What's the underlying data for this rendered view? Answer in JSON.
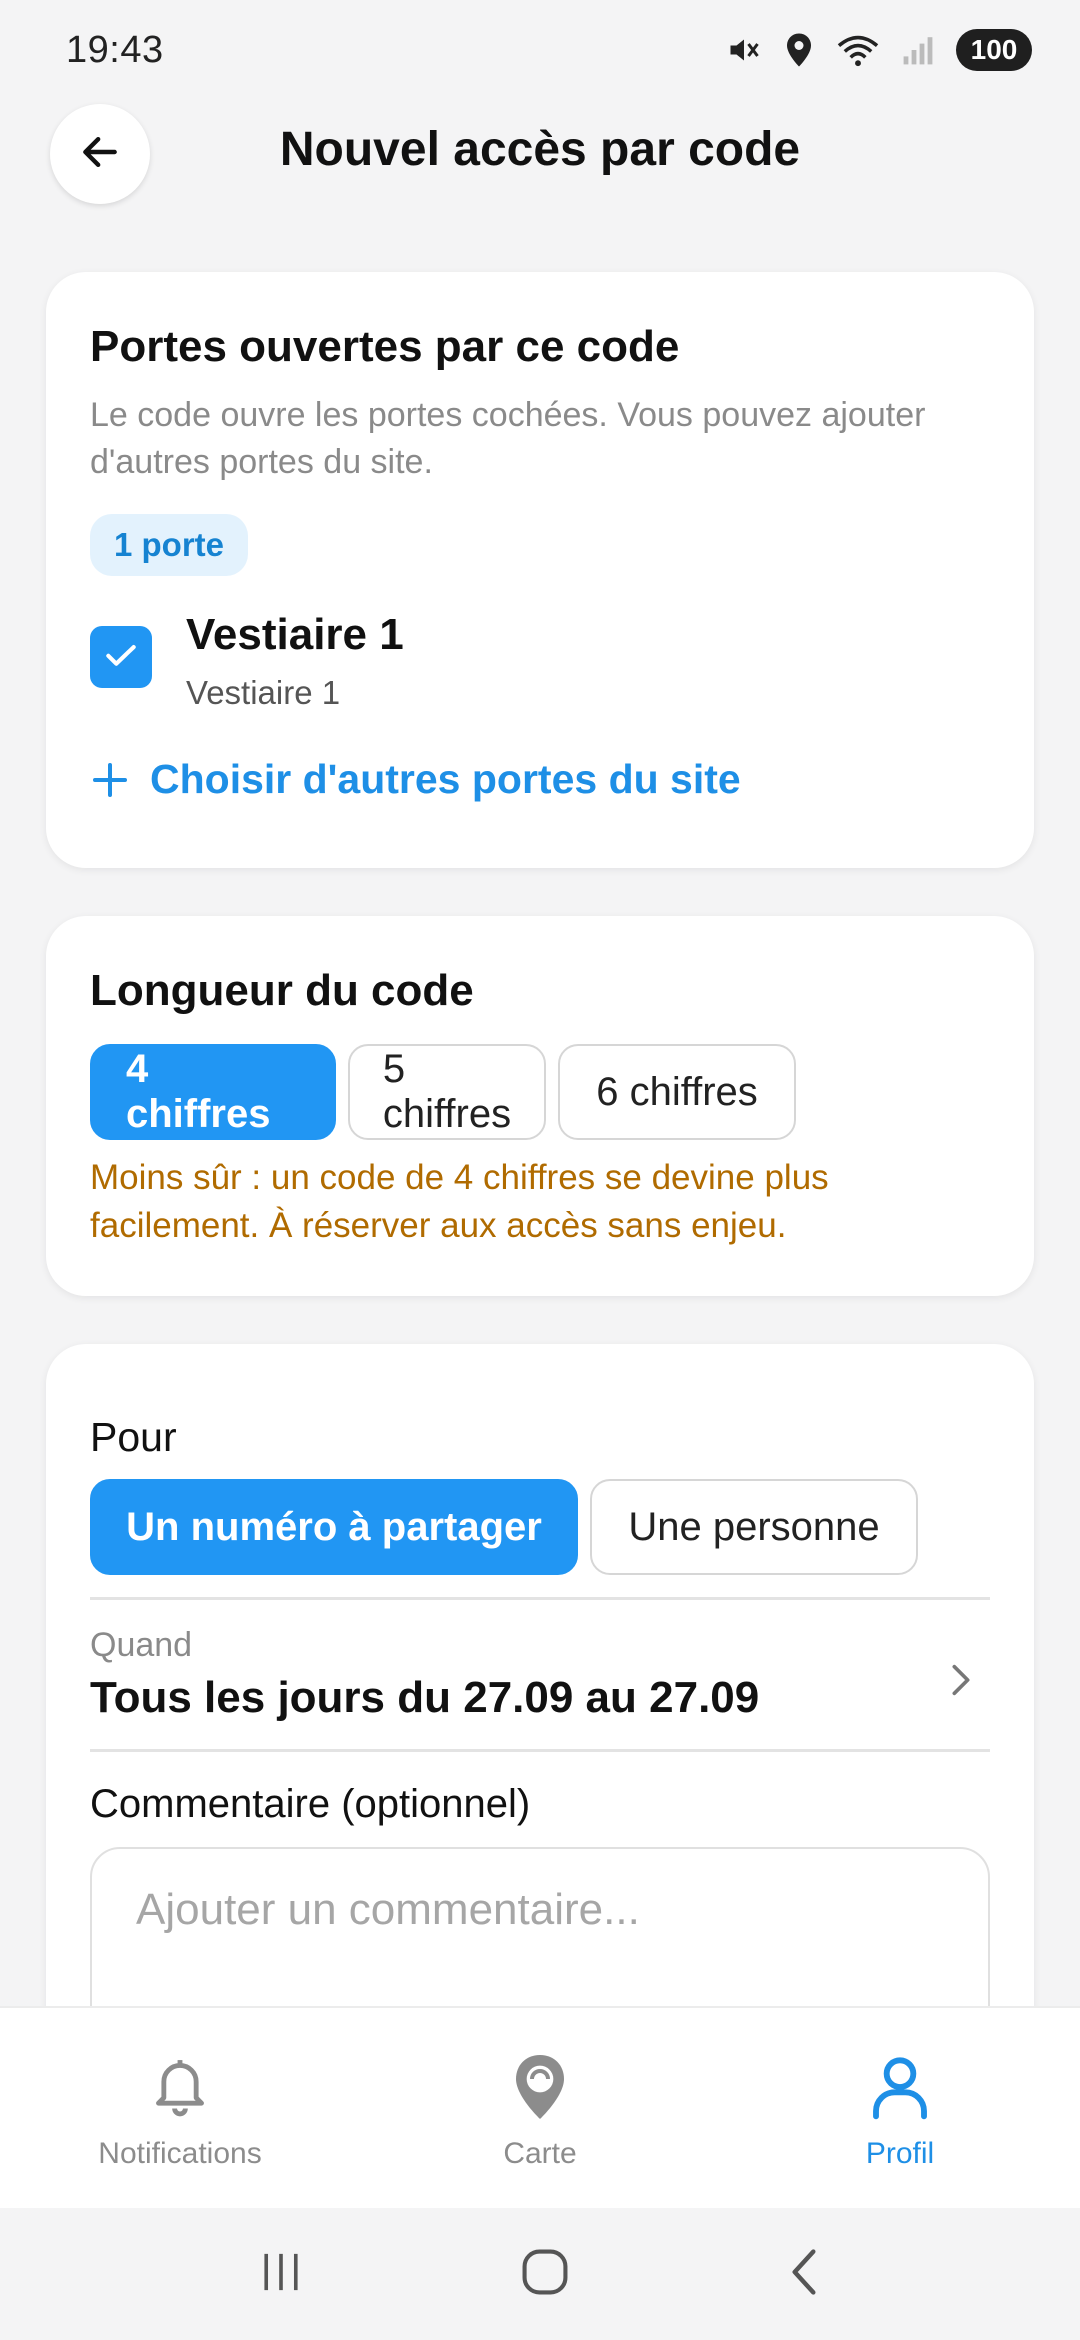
{
  "status_bar": {
    "time": "19:43",
    "battery": "100"
  },
  "header": {
    "title": "Nouvel accès par code",
    "back_icon": "arrow-left-icon"
  },
  "doors_card": {
    "title": "Portes ouvertes par ce code",
    "description": "Le code ouvre les portes cochées. Vous pouvez ajouter d'autres portes du site.",
    "count_badge": "1 porte",
    "doors": [
      {
        "name": "Vestiaire 1",
        "subtitle": "Vestiaire 1",
        "checked": true
      }
    ],
    "add_link": "Choisir d'autres portes du site"
  },
  "length_card": {
    "title": "Longueur du code",
    "options": [
      "4 chiffres",
      "5 chiffres",
      "6 chiffres"
    ],
    "selected": "4 chiffres",
    "warning": "Moins sûr : un code de 4 chiffres se devine plus facilement. À réserver aux accès sans enjeu."
  },
  "for_card": {
    "label": "Pour",
    "options": [
      "Un numéro à partager",
      "Une personne"
    ],
    "selected": "Un numéro à partager",
    "when_label": "Quand",
    "when_value": "Tous les jours du 27.09 au 27.09",
    "comment_label": "Commentaire (optionnel)",
    "comment_placeholder": "Ajouter un commentaire...",
    "comment_value": ""
  },
  "bottom_nav": {
    "items": [
      {
        "label": "Notifications",
        "icon": "bell-icon",
        "active": false
      },
      {
        "label": "Carte",
        "icon": "map-pin-icon",
        "active": false
      },
      {
        "label": "Profil",
        "icon": "user-icon",
        "active": true
      }
    ]
  },
  "colors": {
    "accent": "#2196f3",
    "link": "#1e8fe6",
    "warning": "#b06b00",
    "background": "#f4f4f5"
  }
}
